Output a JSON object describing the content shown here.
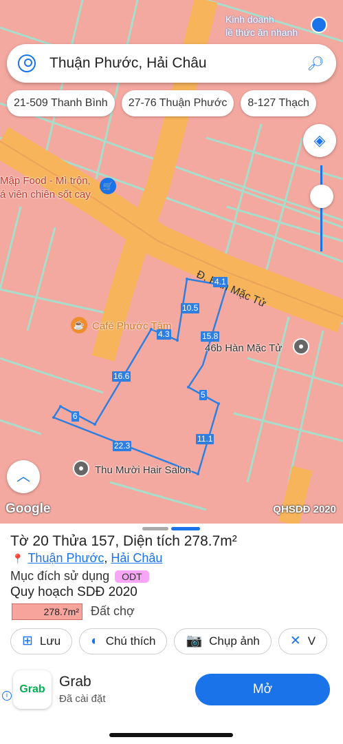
{
  "top_ad": {
    "line1": "Kinh doanh",
    "line2": "lề thức ăn nhanh",
    "icon": "location-icon"
  },
  "search": {
    "query": "Thuận Phước, Hải Châu",
    "left_icon": "account-icon",
    "right_icon": "search-icon"
  },
  "chips": [
    "21-509 Thanh Bình",
    "27-76 Thuận Phước",
    "8-127 Thạch"
  ],
  "map": {
    "labels": {
      "food_line1": "Mập Food - Mì trộn,",
      "food_line2": "á viên chiên sốt cay",
      "cafe": "Café Phước Tâm",
      "street": "Đ. Hàn Mặc Tử",
      "address_poi": "46b Hàn Mặc Tử",
      "salon": "Thu Mười Hair Salon"
    },
    "dimensions": [
      "4.1",
      "10.5",
      "4.3",
      "15.8",
      "16.6",
      "5",
      "6",
      "22.3",
      "11.1"
    ],
    "google_logo": "Google",
    "layer_name": "QHSDĐ 2020",
    "colors": {
      "land": "#f4a9a0",
      "road": "#f7b45a",
      "parcel_line": "#2f7fe0",
      "lot_line": "#9fe3d0"
    }
  },
  "sheet": {
    "title": "Tờ 20 Thửa 157, Diện tích 278.7m²",
    "address_part1": "Thuận Phước",
    "address_sep": ", ",
    "address_part2": "Hải Châu",
    "purpose_label": "Mục đích sử dụng",
    "purpose_code": "ODT",
    "plan_title": "Quy hoạch SDĐ 2020",
    "area": "278.7m²",
    "land_type": "Đất chợ",
    "actions": [
      {
        "label": "Lưu",
        "icon": "add-bookmark-icon"
      },
      {
        "label": "Chú thích",
        "icon": "contrast-icon"
      },
      {
        "label": "Chụp ảnh",
        "icon": "camera-icon"
      },
      {
        "label": "V",
        "icon": "measure-icon"
      }
    ]
  },
  "ad": {
    "logo_text": "Grab",
    "name": "Grab",
    "subtitle": "Đã cài đặt",
    "button": "Mở",
    "info_icon": "info-icon"
  }
}
